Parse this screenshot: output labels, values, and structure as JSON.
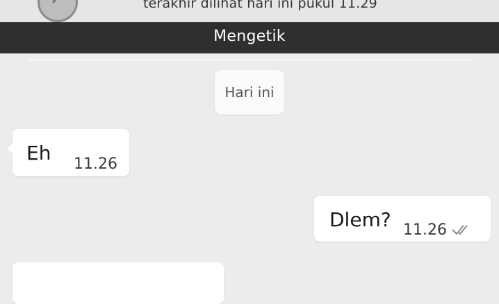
{
  "header": {
    "last_seen": "terakhir dilihat hari ini pukul 11.29",
    "status": "Mengetik"
  },
  "chat": {
    "date_label": "Hari ini",
    "messages": [
      {
        "direction": "incoming",
        "text": "Eh",
        "time": "11.26"
      },
      {
        "direction": "outgoing",
        "text": "Dlem?",
        "time": "11.26",
        "status_icon": "double-check-icon"
      },
      {
        "direction": "incoming",
        "text": ""
      }
    ]
  }
}
